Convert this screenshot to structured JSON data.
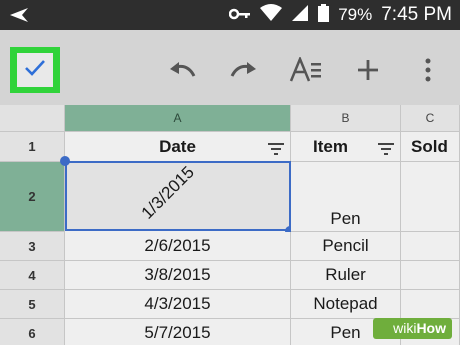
{
  "statusbar": {
    "battery": "79%",
    "time": "7:45 PM"
  },
  "toolbar": {
    "icons": [
      "checkmark-icon",
      "undo-icon",
      "redo-icon",
      "text-format-icon",
      "add-icon",
      "more-vert-icon"
    ]
  },
  "sheet": {
    "columns": [
      "A",
      "B",
      "C"
    ],
    "rows": [
      "1",
      "2",
      "3",
      "4",
      "5",
      "6"
    ],
    "headers": {
      "date": "Date",
      "item": "Item",
      "sold": "Sold"
    },
    "data": [
      {
        "date": "1/3/2015",
        "item": "Pen"
      },
      {
        "date": "2/6/2015",
        "item": "Pencil"
      },
      {
        "date": "3/8/2015",
        "item": "Ruler"
      },
      {
        "date": "4/3/2015",
        "item": "Notepad"
      },
      {
        "date": "5/7/2015",
        "item": "Pen"
      }
    ]
  },
  "watermark": {
    "prefix": "wiki",
    "suffix": "How"
  }
}
